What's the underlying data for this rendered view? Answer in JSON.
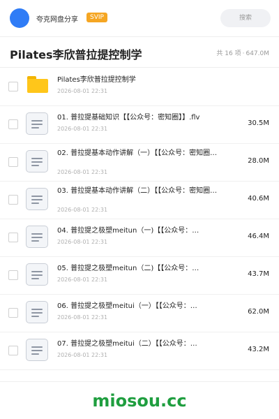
{
  "header": {
    "share_title": "夸克网盘分享",
    "badge": "SVIP",
    "search_placeholder": "搜索",
    "avatar_color": "#2f7cf6",
    "badge_color": "#f5a623"
  },
  "folder": {
    "title": "Pilates李欣普拉提控制学",
    "item_count": "共 16 项",
    "separator": "·",
    "total_size": "647.0M"
  },
  "items": [
    {
      "type": "folder",
      "name": "Pilates李欣普拉提控制学",
      "date": "2026-08-01 22:31",
      "size": ""
    },
    {
      "type": "file",
      "name": "01. 普拉提基础知识【【公众号：密知圈】】.flv",
      "date": "2026-08-01 22:31",
      "size": "30.5M"
    },
    {
      "type": "file",
      "name": "02. 普拉提基本动作讲解（一）【【公众号：密知圈…",
      "date": "2026-08-01 22:31",
      "size": "28.0M"
    },
    {
      "type": "file",
      "name": "03. 普拉提基本动作讲解（二）【【公众号：密知圈…",
      "date": "2026-08-01 22:31",
      "size": "40.6M"
    },
    {
      "type": "file",
      "name": "04. 普拉提之极塑meitun（一)【【公众号：…",
      "date": "2026-08-01 22:31",
      "size": "46.4M"
    },
    {
      "type": "file",
      "name": "05. 普拉提之极塑meitun（二)【【公众号：…",
      "date": "2026-08-01 22:31",
      "size": "43.7M"
    },
    {
      "type": "file",
      "name": "06. 普拉提之极塑meitui（一）【【公众号：…",
      "date": "2026-08-01 22:31",
      "size": "62.0M"
    },
    {
      "type": "file",
      "name": "07. 普拉提之极塑meitui（二）【【公众号：…",
      "date": "2026-08-01 22:31",
      "size": "43.2M"
    }
  ],
  "footer": {
    "brand": "miosou.cc",
    "brand_color": "#1f9e3f"
  }
}
